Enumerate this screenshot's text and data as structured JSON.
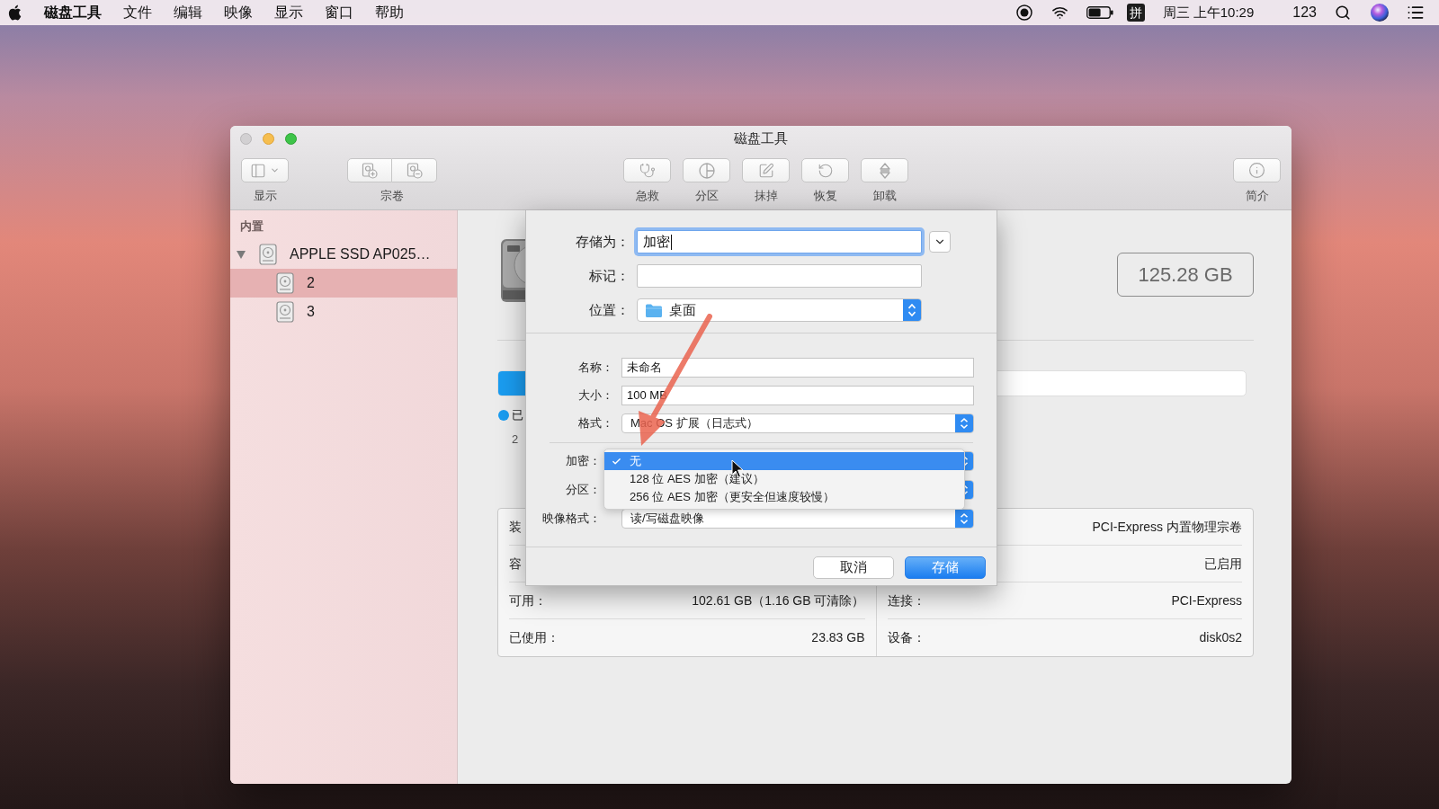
{
  "menu_bar": {
    "app_name": "磁盘工具",
    "menus": [
      "文件",
      "编辑",
      "映像",
      "显示",
      "窗口",
      "帮助"
    ],
    "input_method": "拼",
    "clock": "周三 上午10:29",
    "user": "123"
  },
  "window": {
    "title": "磁盘工具",
    "toolbar": {
      "left": [
        {
          "kind": "sidebar",
          "label": "显示"
        },
        {
          "kind": "volume",
          "label": "宗卷"
        }
      ],
      "center": [
        {
          "kind": "first_aid",
          "label": "急救"
        },
        {
          "kind": "partition",
          "label": "分区"
        },
        {
          "kind": "erase",
          "label": "抹掉"
        },
        {
          "kind": "restore",
          "label": "恢复"
        },
        {
          "kind": "unmount",
          "label": "卸载"
        }
      ],
      "right": [
        {
          "kind": "info",
          "label": "简介"
        }
      ]
    }
  },
  "sidebar": {
    "section": "内置",
    "items": [
      {
        "label": "APPLE SSD AP025…",
        "expanded": true,
        "selected": false,
        "children": [
          {
            "label": "2",
            "selected": true
          },
          {
            "label": "3",
            "selected": false
          }
        ]
      }
    ]
  },
  "detail": {
    "capacity": "125.28 GB",
    "usage_bar": {
      "level": 0.19
    },
    "legend": {
      "label": "已",
      "value": "2"
    },
    "info_table": {
      "left": [
        {
          "label": "装"
        },
        {
          "label": "容"
        },
        {
          "label": "可用：",
          "value": "102.61 GB（1.16 GB 可清除）"
        },
        {
          "label": "已使用：",
          "value": "23.83 GB"
        }
      ],
      "right": [
        {
          "value": "PCI-Express 内置物理宗卷"
        },
        {
          "value": "已启用"
        },
        {
          "label": "连接：",
          "value": "PCI-Express"
        },
        {
          "label": "设备：",
          "value": "disk0s2"
        }
      ]
    }
  },
  "save_sheet": {
    "save_as": {
      "label": "存储为：",
      "value": "加密",
      "focused": true
    },
    "tags": {
      "label": "标记："
    },
    "location": {
      "label": "位置：",
      "value": "桌面"
    },
    "fields": [
      {
        "kind": "text",
        "label": "名称：",
        "value": "未命名"
      },
      {
        "kind": "text",
        "label": "大小：",
        "value": "100 MB"
      },
      {
        "kind": "popup",
        "label": "格式：",
        "value": "Mac OS 扩展（日志式）"
      }
    ],
    "options": [
      {
        "kind": "popup",
        "label": "加密："
      },
      {
        "kind": "popup",
        "label": "分区："
      },
      {
        "kind": "popup",
        "label": "映像格式：",
        "value": "读/写磁盘映像"
      }
    ],
    "encryption_menu": {
      "items": [
        {
          "label": "无",
          "selected": true
        },
        {
          "label": "128 位 AES 加密（建议）",
          "selected": false
        },
        {
          "label": "256 位 AES 加密（更安全但速度较慢）",
          "selected": false
        }
      ]
    },
    "buttons": [
      {
        "kind": "cancel",
        "label": "取消"
      },
      {
        "kind": "default",
        "label": "存储"
      }
    ]
  }
}
